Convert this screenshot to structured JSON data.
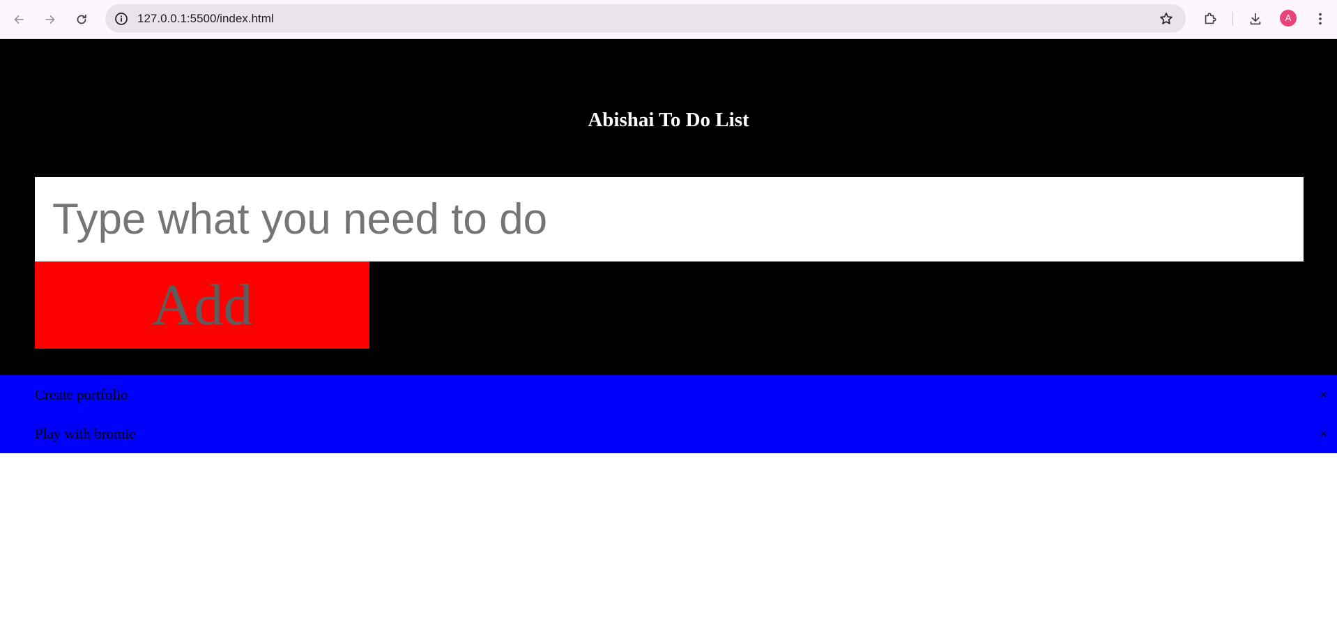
{
  "browser": {
    "url": "127.0.0.1:5500/index.html",
    "profile_initial": "A",
    "profile_color": "#e8437a"
  },
  "app": {
    "title": "Abishai To Do List",
    "input_placeholder": "Type what you need to do",
    "input_value": "",
    "add_label": "Add",
    "colors": {
      "header_bg": "#000000",
      "add_button_bg": "#ff0000",
      "list_bg": "#0000ff"
    },
    "tasks": [
      {
        "text": "Create portfolio",
        "close": "×"
      },
      {
        "text": "Play with bromie",
        "close": "×"
      }
    ]
  }
}
